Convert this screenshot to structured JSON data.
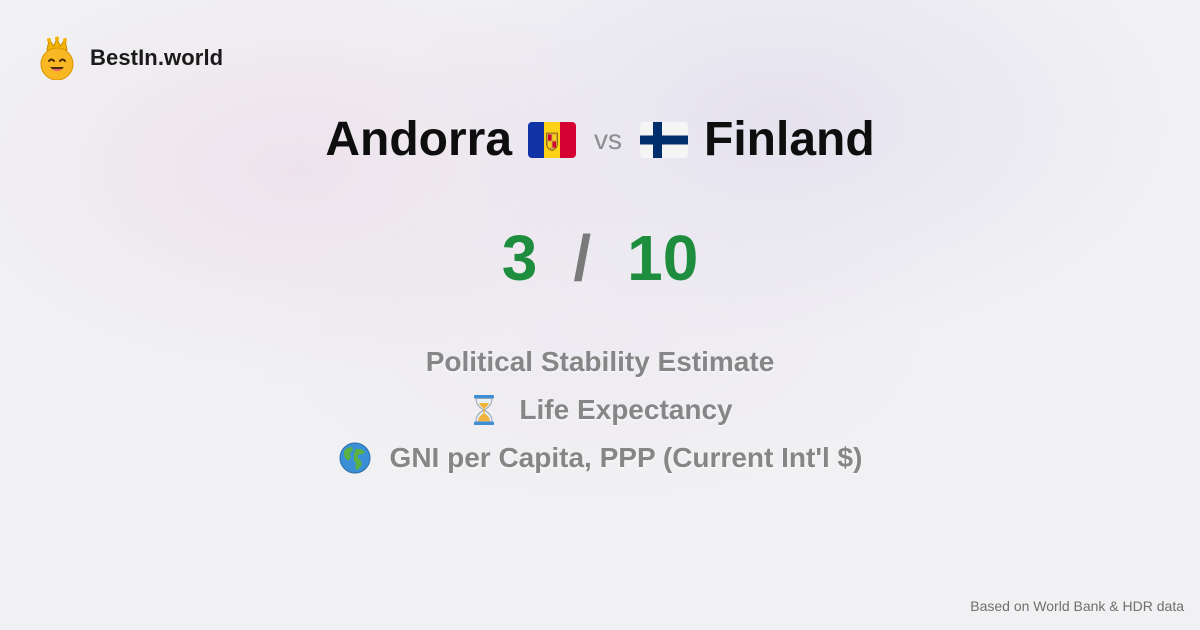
{
  "brand": {
    "name": "BestIn.world",
    "logo_icon": "crowned-smiley-icon"
  },
  "comparison": {
    "country_a": {
      "name": "Andorra",
      "flag": "andorra-flag-icon"
    },
    "vs_label": "vs",
    "country_b": {
      "name": "Finland",
      "flag": "finland-flag-icon"
    }
  },
  "score": {
    "a": "3",
    "separator": "/",
    "b": "10",
    "color": "#1e8e3e"
  },
  "metrics": [
    {
      "icon": "",
      "label": "Political Stability Estimate"
    },
    {
      "icon": "hourglass-icon",
      "label": "Life Expectancy"
    },
    {
      "icon": "globe-icon",
      "label": "GNI per Capita, PPP (Current Int'l $)"
    }
  ],
  "footer": {
    "source": "Based on World Bank & HDR data"
  }
}
